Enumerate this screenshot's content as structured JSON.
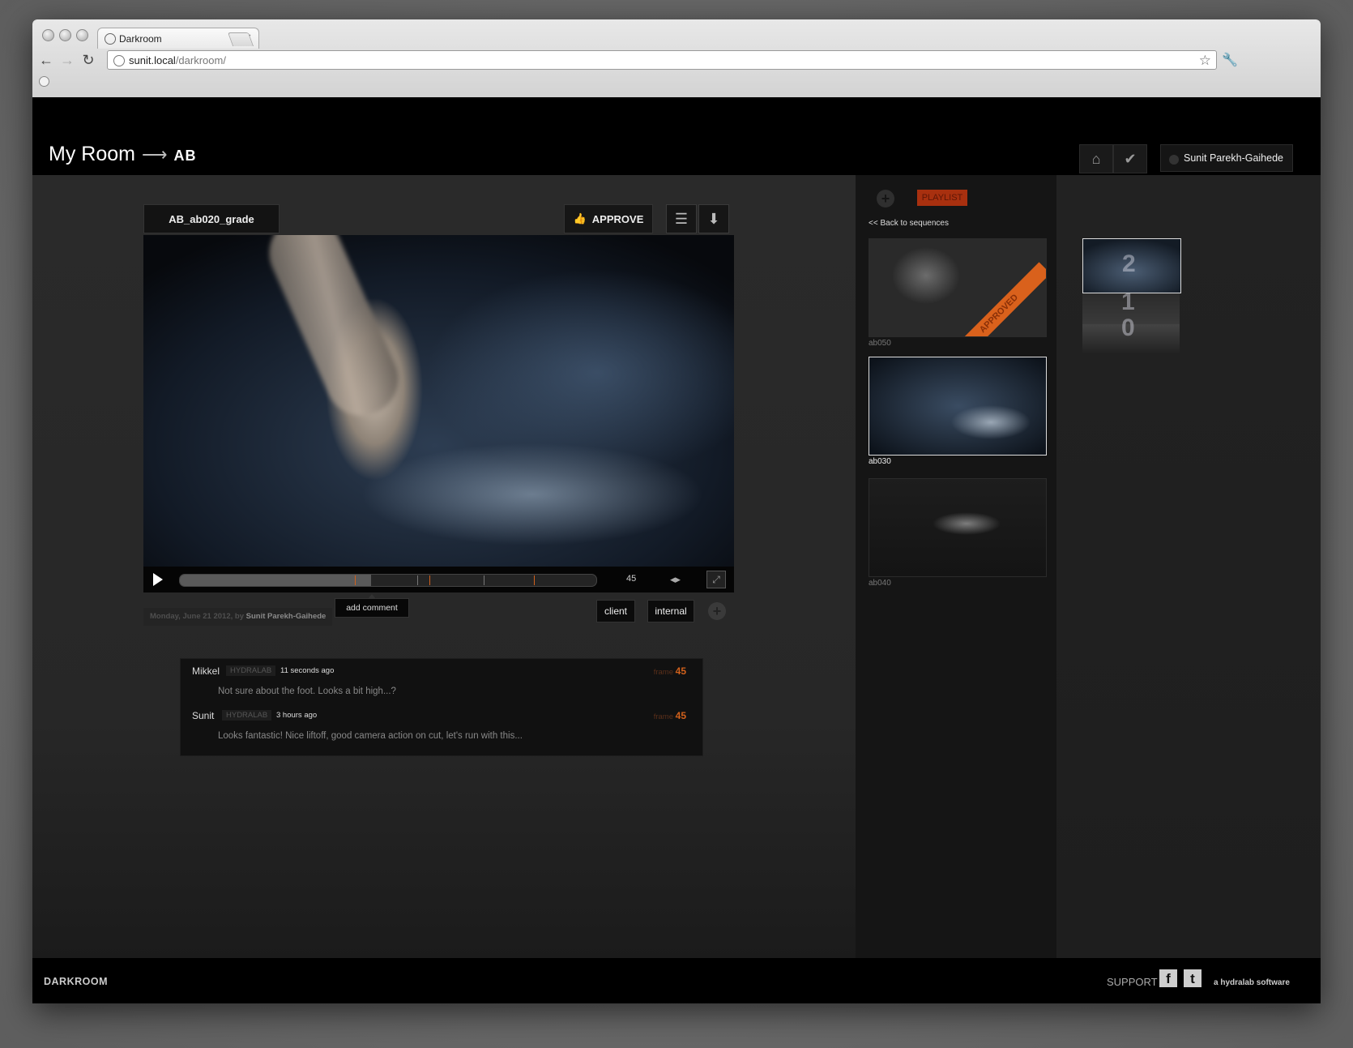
{
  "browser": {
    "tab_title": "Darkroom",
    "url_host": "sunit.local",
    "url_path": "/darkroom/"
  },
  "header": {
    "crumb_room": "My Room",
    "crumb_arrow": "⟶",
    "crumb_project": "AB",
    "user_name": "Sunit Parekh-Gaihede"
  },
  "player": {
    "shot_title": "AB_ab020_grade",
    "approve_label": "APPROVE",
    "frame": "45",
    "progress_fraction": 0.46,
    "markers": [
      0.42,
      0.57,
      0.6,
      0.73,
      0.85
    ],
    "add_comment_label": "add comment",
    "meta_date": "Monday, June 21 2012, by",
    "meta_author": "Sunit Parekh-Gaihede",
    "tags": [
      "client",
      "internal"
    ]
  },
  "comments": [
    {
      "name": "Mikkel",
      "org": "HYDRALAB",
      "time": "11 seconds ago",
      "frame_label": "frame",
      "frame": "45",
      "text": "Not sure about the foot.  Looks a bit high...?"
    },
    {
      "name": "Sunit",
      "org": "HYDRALAB",
      "time": "3 hours ago",
      "frame_label": "frame",
      "frame": "45",
      "text": "Looks fantastic!  Nice liftoff, good camera action on cut, let's run with this..."
    }
  ],
  "sidebar": {
    "playlist_label": "PLAYLIST",
    "back_label": "<< Back to sequences",
    "shots": [
      {
        "label": "ab050",
        "approved_label": "APPROVED"
      },
      {
        "label": "ab030"
      },
      {
        "label": "ab040"
      }
    ]
  },
  "stack": {
    "numbers": [
      "2",
      "1",
      "0"
    ]
  },
  "footer": {
    "brand": "DARKROOM",
    "support": "SUPPORT",
    "credit": "a hydralab software"
  },
  "colors": {
    "accent": "#d2611c",
    "playlist_bg": "#a8300f"
  }
}
